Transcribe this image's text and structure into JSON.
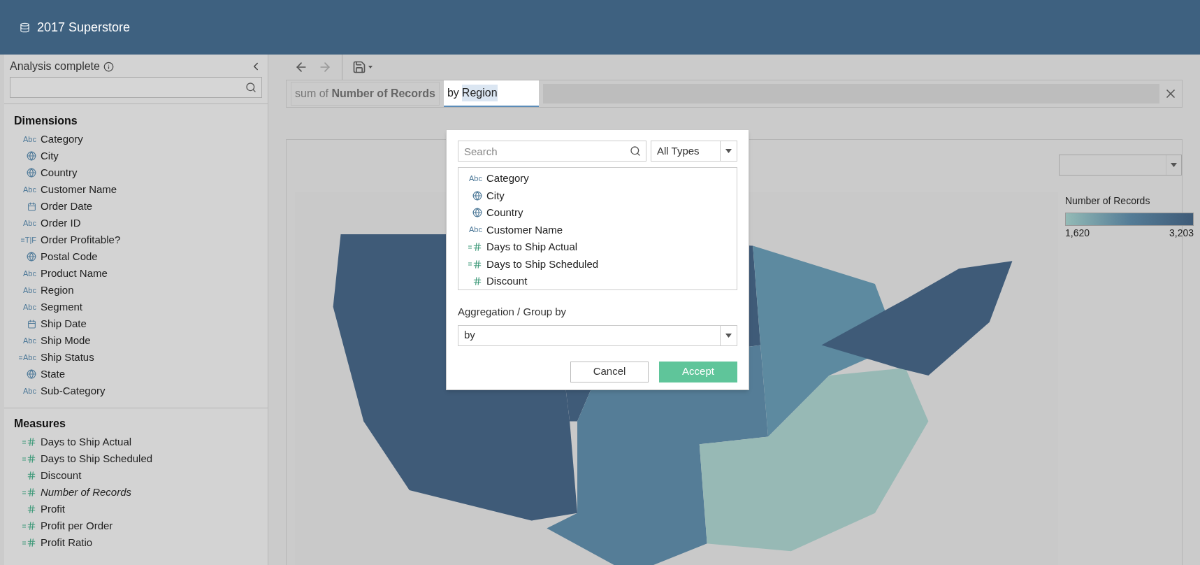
{
  "header": {
    "title": "2017 Superstore"
  },
  "sidebar": {
    "status": "Analysis complete",
    "dimensions": {
      "title": "Dimensions",
      "items": [
        {
          "name": "Category",
          "kind": "string",
          "glyph": "Abc",
          "calculated": false
        },
        {
          "name": "City",
          "kind": "geo",
          "calculated": false
        },
        {
          "name": "Country",
          "kind": "geo",
          "calculated": false
        },
        {
          "name": "Customer Name",
          "kind": "string",
          "glyph": "Abc",
          "calculated": false
        },
        {
          "name": "Order Date",
          "kind": "date",
          "calculated": false
        },
        {
          "name": "Order ID",
          "kind": "string",
          "glyph": "Abc",
          "calculated": false
        },
        {
          "name": "Order Profitable?",
          "kind": "bool",
          "glyph": "T|F",
          "calculated": true
        },
        {
          "name": "Postal Code",
          "kind": "geo",
          "calculated": false
        },
        {
          "name": "Product Name",
          "kind": "string",
          "glyph": "Abc",
          "calculated": false
        },
        {
          "name": "Region",
          "kind": "string",
          "glyph": "Abc",
          "calculated": false
        },
        {
          "name": "Segment",
          "kind": "string",
          "glyph": "Abc",
          "calculated": false
        },
        {
          "name": "Ship Date",
          "kind": "date",
          "calculated": false
        },
        {
          "name": "Ship Mode",
          "kind": "string",
          "glyph": "Abc",
          "calculated": false
        },
        {
          "name": "Ship Status",
          "kind": "string",
          "glyph": "Abc",
          "calculated": true
        },
        {
          "name": "State",
          "kind": "geo",
          "calculated": false
        },
        {
          "name": "Sub-Category",
          "kind": "string",
          "glyph": "Abc",
          "calculated": false
        }
      ]
    },
    "measures": {
      "title": "Measures",
      "items": [
        {
          "name": "Days to Ship Actual",
          "kind": "number",
          "calculated": true,
          "italic": false
        },
        {
          "name": "Days to Ship Scheduled",
          "kind": "number",
          "calculated": true,
          "italic": false
        },
        {
          "name": "Discount",
          "kind": "number",
          "calculated": false,
          "italic": false
        },
        {
          "name": "Number of Records",
          "kind": "number",
          "calculated": true,
          "italic": true
        },
        {
          "name": "Profit",
          "kind": "number",
          "calculated": false,
          "italic": false
        },
        {
          "name": "Profit per Order",
          "kind": "number",
          "calculated": true,
          "italic": false
        },
        {
          "name": "Profit Ratio",
          "kind": "number",
          "calculated": true,
          "italic": false
        }
      ]
    }
  },
  "query": {
    "chip": "sum of **Number of Records**",
    "input": [
      {
        "text": "by",
        "selected": false
      },
      {
        "text": "Region",
        "selected": true
      }
    ]
  },
  "popup": {
    "search": {
      "placeholder": "Search"
    },
    "type_filter": "All Types",
    "items": [
      {
        "name": "Category",
        "kind": "string",
        "glyph": "Abc",
        "calculated": false
      },
      {
        "name": "City",
        "kind": "geo",
        "calculated": false
      },
      {
        "name": "Country",
        "kind": "geo",
        "calculated": false
      },
      {
        "name": "Customer Name",
        "kind": "string",
        "glyph": "Abc",
        "calculated": false
      },
      {
        "name": "Days to Ship Actual",
        "kind": "number",
        "calculated": true
      },
      {
        "name": "Days to Ship Scheduled",
        "kind": "number",
        "calculated": true
      },
      {
        "name": "Discount",
        "kind": "number",
        "calculated": false
      }
    ],
    "aggregation_label": "Aggregation / Group by",
    "aggregation_value": "by",
    "buttons": [
      {
        "label": "Cancel",
        "kind": "secondary"
      },
      {
        "label": "Accept",
        "kind": "primary"
      }
    ]
  },
  "legend": {
    "title": "Number of Records",
    "min": "1,620",
    "max": "3,203"
  }
}
